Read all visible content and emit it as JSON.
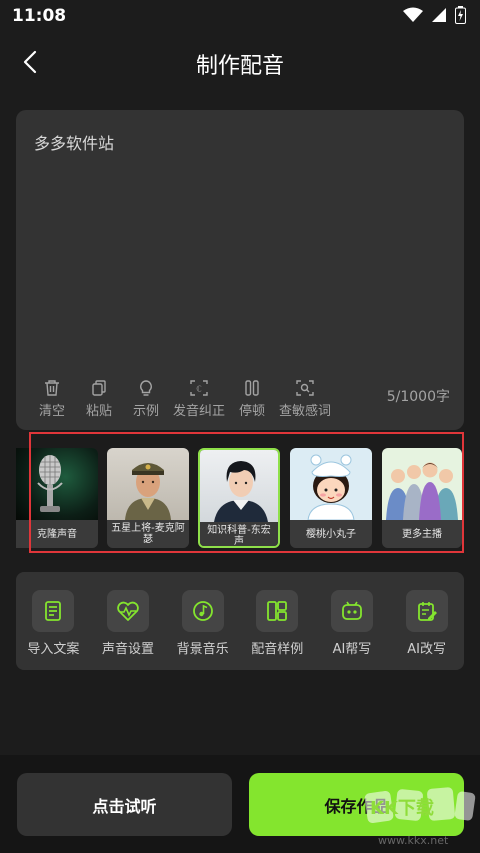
{
  "status": {
    "time": "11:08"
  },
  "header": {
    "title": "制作配音"
  },
  "editor": {
    "text": "多多软件站",
    "counter": "5/1000字",
    "tools": [
      {
        "label": "清空",
        "icon": "trash-icon"
      },
      {
        "label": "粘贴",
        "icon": "paste-icon"
      },
      {
        "label": "示例",
        "icon": "lightbulb-icon"
      },
      {
        "label": "发音纠正",
        "icon": "pronunciation-icon"
      },
      {
        "label": "停顿",
        "icon": "pause-icon"
      },
      {
        "label": "查敏感词",
        "icon": "scan-icon"
      }
    ]
  },
  "voices": [
    {
      "label": "克隆声音",
      "image": "microphone"
    },
    {
      "label": "五星上将-麦克阿瑟",
      "image": "general-portrait"
    },
    {
      "label": "知识科普-东宏声",
      "image": "young-man-portrait",
      "selected": true
    },
    {
      "label": "樱桃小丸子",
      "image": "cartoon-girl"
    },
    {
      "label": "更多主播",
      "image": "group-figures"
    }
  ],
  "features": [
    {
      "label": "导入文案",
      "icon": "document-icon"
    },
    {
      "label": "声音设置",
      "icon": "heart-wave-icon"
    },
    {
      "label": "背景音乐",
      "icon": "music-note-icon"
    },
    {
      "label": "配音样例",
      "icon": "layout-icon"
    },
    {
      "label": "AI帮写",
      "icon": "robot-icon"
    },
    {
      "label": "AI改写",
      "icon": "edit-note-icon"
    }
  ],
  "actions": {
    "listen": "点击试听",
    "save": "保存作品"
  },
  "watermark": {
    "text": "KK下载",
    "url": "www.kkx.net"
  },
  "colors": {
    "accent": "#84e52e",
    "highlight": "#e0363a",
    "background": "#1c1c1c",
    "panel": "#333333"
  }
}
